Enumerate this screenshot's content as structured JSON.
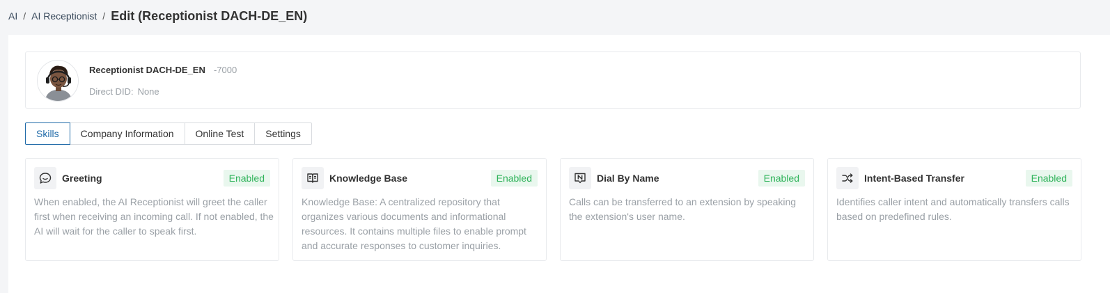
{
  "breadcrumb": {
    "root": "AI",
    "section": "AI Receptionist",
    "current": "Edit (Receptionist DACH-DE_EN)",
    "separator": "/"
  },
  "profile": {
    "name": "Receptionist DACH-DE_EN",
    "extension": "-7000",
    "did_label": "Direct DID:",
    "did_value": "None"
  },
  "tabs": [
    {
      "label": "Skills",
      "active": true
    },
    {
      "label": "Company Information",
      "active": false
    },
    {
      "label": "Online Test",
      "active": false
    },
    {
      "label": "Settings",
      "active": false
    }
  ],
  "skills": [
    {
      "icon": "chat-bubble-icon",
      "title": "Greeting",
      "status": "Enabled",
      "description": "When enabled, the AI Receptionist will greet the caller first when receiving an incoming call. If not enabled, the AI will wait for the caller to speak first."
    },
    {
      "icon": "book-icon",
      "title": "Knowledge Base",
      "status": "Enabled",
      "description": "Knowledge Base: A centralized repository that organizes various documents and informational resources. It contains multiple files to enable prompt and accurate responses to customer inquiries."
    },
    {
      "icon": "name-tag-icon",
      "title": "Dial By Name",
      "status": "Enabled",
      "description": "Calls can be transferred to an extension by speaking the extension's user name."
    },
    {
      "icon": "shuffle-icon",
      "title": "Intent-Based Transfer",
      "status": "Enabled",
      "description": "Identifies caller intent and automatically transfers calls based on predefined rules."
    }
  ],
  "colors": {
    "accent": "#1f6aa8",
    "enabled_text": "#2fb35a",
    "enabled_bg": "#e9f7ee",
    "page_bg": "#f4f5f7"
  }
}
